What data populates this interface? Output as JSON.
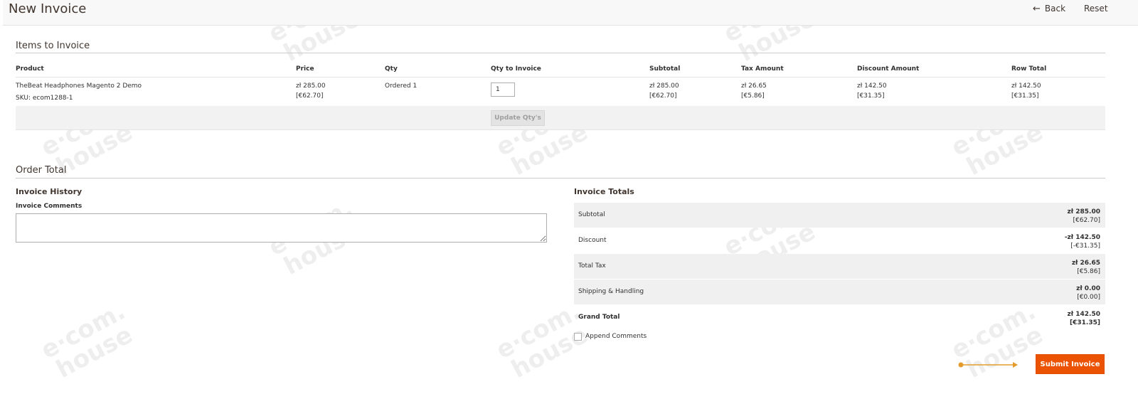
{
  "header": {
    "title": "New Invoice",
    "back_label": "Back",
    "reset_label": "Reset"
  },
  "items_section": {
    "title": "Items to Invoice",
    "columns": [
      "Product",
      "Price",
      "Qty",
      "Qty to Invoice",
      "Subtotal",
      "Tax Amount",
      "Discount Amount",
      "Row Total"
    ],
    "rows": [
      {
        "product_name": "TheBeat Headphones Magento 2 Demo",
        "sku": "SKU: ecom1288-1",
        "price": "zł 285.00",
        "price_alt": "[€62.70]",
        "qty": "Ordered 1",
        "qty_to_invoice": "1",
        "subtotal": "zł 285.00",
        "subtotal_alt": "[€62.70]",
        "tax_amount": "zł 26.65",
        "tax_amount_alt": "[€5.86]",
        "discount_amount": "zł 142.50",
        "discount_amount_alt": "[€31.35]",
        "row_total": "zł 142.50",
        "row_total_alt": "[€31.35]"
      }
    ],
    "update_button_label": "Update Qty's"
  },
  "order_total": {
    "title": "Order Total",
    "history": {
      "title": "Invoice History",
      "comments_label": "Invoice Comments",
      "comments_value": ""
    },
    "totals": {
      "title": "Invoice Totals",
      "rows": [
        {
          "label": "Subtotal",
          "value": "zł 285.00",
          "alt": "[€62.70]"
        },
        {
          "label": "Discount",
          "value": "-zł 142.50",
          "alt": "[-€31.35]"
        },
        {
          "label": "Total Tax",
          "value": "zł 26.65",
          "alt": "[€5.86]"
        },
        {
          "label": "Shipping & Handling",
          "value": "zł 0.00",
          "alt": "[€0.00]"
        },
        {
          "label": "Grand Total",
          "value": "zł 142.50",
          "alt": "[€31.35]"
        }
      ],
      "append_comments_label": "Append Comments",
      "append_comments_checked": false,
      "submit_label": "Submit Invoice"
    }
  },
  "colors": {
    "accent": "#eb5202",
    "pointer_arrow": "#e39b2c",
    "shaded_row": "#f0f0f0"
  }
}
